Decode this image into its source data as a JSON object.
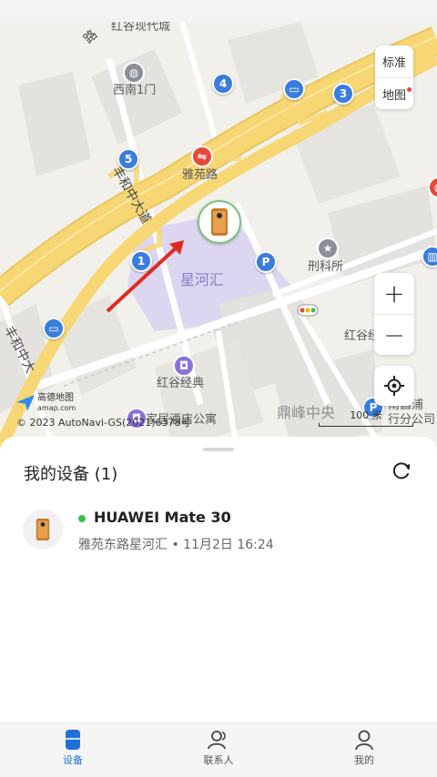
{
  "map": {
    "labels": {
      "hongguxiandaicheng": "红谷现代城",
      "xinan1men": "西南1门",
      "yayuanlu": "雅苑路",
      "fenghezhongdadao": "丰和中大道",
      "fenghezhong": "丰和中大",
      "xingheh": "星河汇",
      "xingkesuo": "刑科所",
      "hongguj": "红谷经典",
      "hongguj2": "红谷经典",
      "jiajujiudian": "家居酒店公寓",
      "dingfeng": "鼎峰中央",
      "nanchang": "南昌浦",
      "xingfenggongsi": "行分公司",
      "lu": "路"
    },
    "pins": {
      "p4": "4",
      "p3": "3",
      "p5": "5",
      "p1": "1"
    },
    "layer_standard": "标准",
    "layer_map": "地图",
    "zoom_in": "+",
    "zoom_out": "−",
    "amap_name": "高德地图",
    "amap_domain": "amap.com",
    "copyright": "© 2023 AutoNavi-GS(2021)6378号",
    "scale": "100 米"
  },
  "sheet": {
    "title": "我的设备 (1)",
    "device": {
      "name": "HUAWEI Mate 30",
      "status_color": "#3bbf4c",
      "meta": "雅苑东路星河汇 • 11月2日 16:24"
    }
  },
  "tabs": [
    {
      "label": "设备",
      "icon": "device-icon",
      "active": true
    },
    {
      "label": "联系人",
      "icon": "contacts-icon",
      "active": false
    },
    {
      "label": "我的",
      "icon": "profile-icon",
      "active": false
    }
  ],
  "colors": {
    "accent": "#1f6fd8",
    "road_yellow": "#f7d774",
    "online": "#3bbf4c"
  }
}
